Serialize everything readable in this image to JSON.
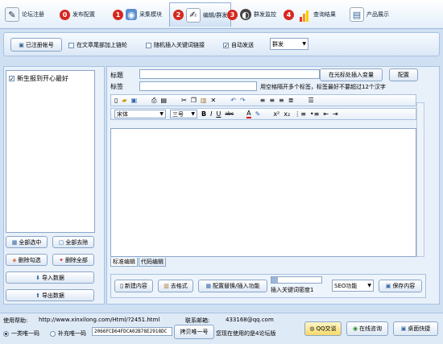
{
  "tabs": [
    {
      "label": "论坛注册",
      "num": "",
      "icon": "register-icon"
    },
    {
      "label": "发布配置",
      "num": "0",
      "icon": "publish-config-icon"
    },
    {
      "label": "采集模块",
      "num": "1",
      "icon": "collect-icon"
    },
    {
      "label": "编辑/群发",
      "num": "2",
      "icon": "edit-icon"
    },
    {
      "label": "群发监控",
      "num": "3",
      "icon": "monitor-icon"
    },
    {
      "label": "查询结果",
      "num": "4",
      "icon": "chart-icon"
    },
    {
      "label": "产品展示",
      "num": "",
      "icon": "product-icon"
    }
  ],
  "toolbar": {
    "registered_btn": "已注册帐号",
    "opt_tail_link": "在文章尾部加上链轮",
    "opt_random_link": "随机插入关键词链接",
    "opt_auto_send": "自动发送",
    "mode_select": "群发"
  },
  "left": {
    "list_item": "新生报到开心最好",
    "btn_select_all": "全部选中",
    "btn_deselect_all": "全部去除",
    "btn_delete_checked": "删除勾选",
    "btn_delete_all": "删除全部",
    "btn_import": "导入数据",
    "btn_export": "导出数据"
  },
  "editor": {
    "title_label": "标题",
    "tag_label": "标签",
    "insert_var_btn": "在光标处插入变量",
    "config_btn": "配置",
    "tag_hint": "用空格隔开多个标签，标签最好不要超过12个汉字",
    "font_name": "宋体",
    "font_size": "三号",
    "tab_standard": "标准编辑",
    "tab_code": "代码编辑",
    "btn_new": "新建内容",
    "btn_remove_format": "去格式",
    "btn_replace_config": "配置替换/插入功能",
    "keyword_density": "插入关键词密度1",
    "seo_select": "SEO功能",
    "btn_save": "保存内容"
  },
  "footer": {
    "help_label": "使用帮助:",
    "help_url": "http://www.xinxilong.com/Html/?2451.html",
    "contact_label": "联系邮箱:",
    "contact_email": "433168@qq.com",
    "radio_single": "一类唯一码",
    "radio_supplement": "补充唯一码",
    "machine_code": "2066FCD64FDCA02B78E2918DC",
    "copy_btn": "拷贝唯一号",
    "forum_msg": "您现在使用的是4论坛版",
    "qq_btn": "QQ交谈",
    "online_btn": "在线咨询",
    "desktop_btn": "桌面快捷"
  }
}
